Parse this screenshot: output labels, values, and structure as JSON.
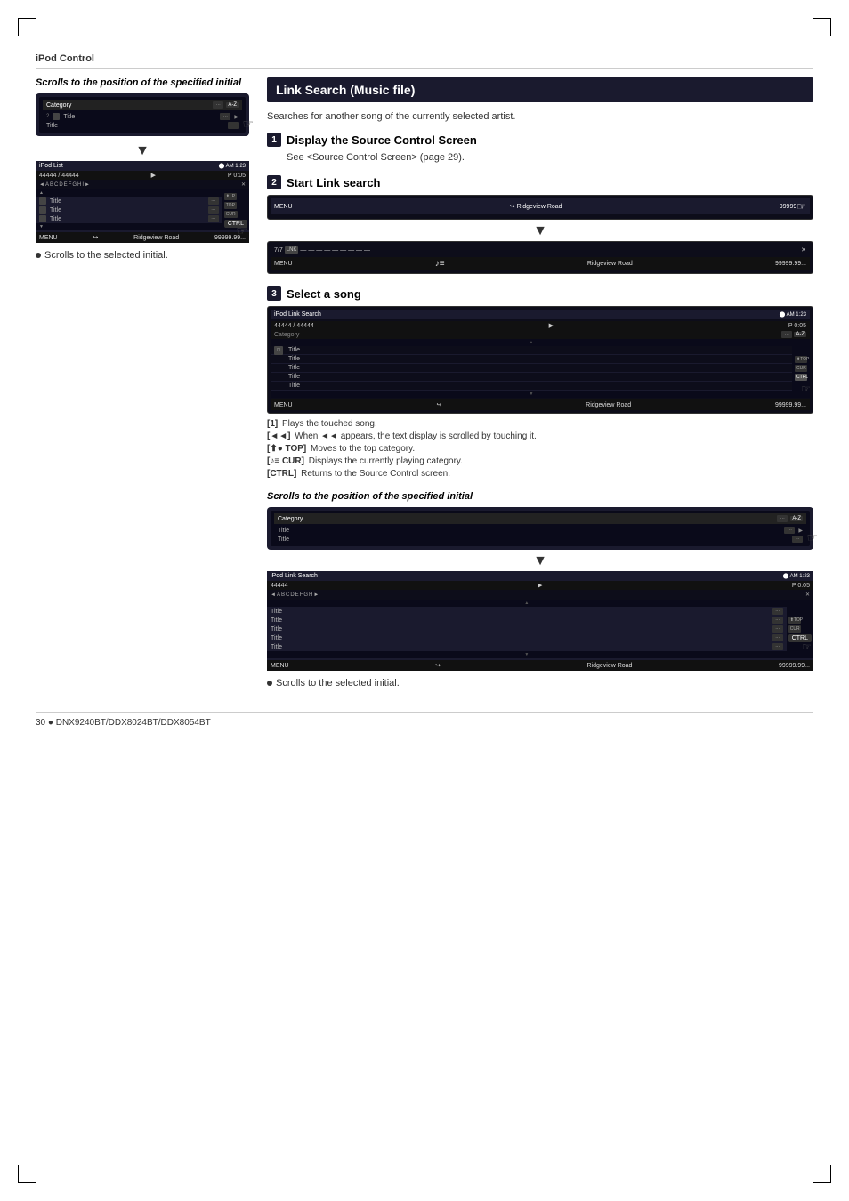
{
  "page": {
    "title": "iPod Control",
    "footer": "30 ● DNX9240BT/DDX8024BT/DDX8054BT"
  },
  "left_section": {
    "caption_italic": "Scrolls to the position of the specified initial",
    "screen1": {
      "category": "Category",
      "counter": "···",
      "az": "A-Z",
      "rows": [
        "Title",
        "Title"
      ]
    },
    "arrow_down": "▼",
    "screen2": {
      "title": "iPod List",
      "counter": "44444 / 44444",
      "position": "P 0:05",
      "nav": [
        "◄",
        "A",
        "B",
        "C",
        "D",
        "E",
        "F",
        "G",
        "H",
        "I",
        "►"
      ],
      "rows": [
        "Title",
        "Title",
        "Title"
      ],
      "btns": [
        "UP",
        "TOP",
        "CUR"
      ],
      "bottom_left": "MENU",
      "bottom_road": "Ridgeview Road",
      "bottom_right": "99999.99..."
    },
    "caption_scrolls": "Scrolls to the selected initial."
  },
  "right_section": {
    "header": "Link Search (Music file)",
    "description": "Searches for another song of the currently selected artist.",
    "steps": [
      {
        "num": "1",
        "title": "Display the Source Control Screen",
        "desc": "See <Source Control Screen> (page 29)."
      },
      {
        "num": "2",
        "title": "Start Link search",
        "screen1": {
          "bottom_left": "MENU",
          "bottom_road": "Ridgeview Road",
          "bottom_right": "99999.99..."
        },
        "screen2": {
          "nav_label": "LNK",
          "bottom_left": "MENU",
          "bottom_road": "Ridgeview Road",
          "bottom_right": "99999.99..."
        }
      },
      {
        "num": "3",
        "title": "Select a song",
        "screen": {
          "title": "iPod Link Search",
          "counter": "44444 / 44444",
          "position": "P 0:05",
          "category": "Category",
          "az": "A-Z",
          "rows": [
            "Title",
            "Title",
            "Title",
            "Title",
            "Title"
          ],
          "btns": [
            "TOP",
            "CUR",
            "CTRL"
          ],
          "bottom_left": "MENU",
          "bottom_road": "Ridgeview Road",
          "bottom_right": "99999.99..."
        },
        "notes": [
          {
            "bracket": "1",
            "text": "Plays the touched song."
          },
          {
            "bracket": "◄◄",
            "text": "When ◄◄ appears, the text display is scrolled by touching it."
          },
          {
            "bracket": "⬆● TOP",
            "text": "Moves to the top category."
          },
          {
            "bracket": "♪≡ CUR",
            "text": "Displays the currently playing category."
          },
          {
            "bracket": "CTRL",
            "text": "Returns to the Source Control screen."
          }
        ]
      }
    ],
    "bottom_caption_italic": "Scrolls to the position of the specified initial",
    "bottom_screen1": {
      "category": "Category",
      "counter": "···",
      "az": "A-Z",
      "rows": [
        "Title",
        "Title"
      ]
    },
    "bottom_arrow": "▼",
    "bottom_screen2": {
      "title": "iPod Link Search",
      "counter": "44444",
      "position": "P 0:05",
      "nav": [
        "◄",
        "A",
        "B",
        "C",
        "D",
        "E",
        "F",
        "G",
        "H",
        "►"
      ],
      "rows": [
        "Title",
        "Title",
        "Title",
        "Title",
        "Title"
      ],
      "btns": [
        "TOP",
        "CUR"
      ],
      "bottom_left": "MENU",
      "bottom_road": "Ridgeview Road",
      "bottom_right": "99999.99..."
    },
    "bottom_caption_scrolls": "Scrolls to the selected initial."
  }
}
